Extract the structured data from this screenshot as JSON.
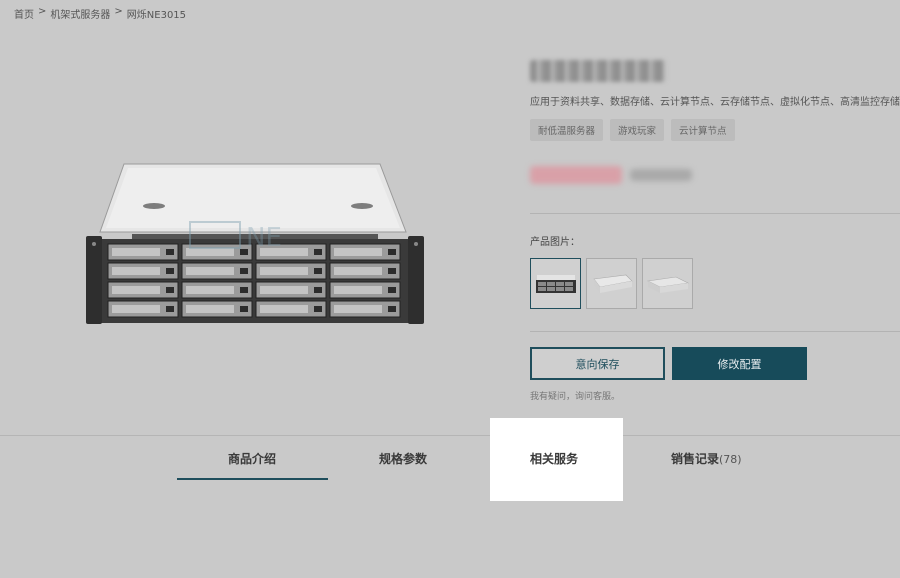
{
  "breadcrumb": {
    "home": "首页",
    "sep1": ">",
    "category": "机架式服务器",
    "sep2": ">",
    "current": "网烁NE3015"
  },
  "product": {
    "description": "应用于资料共享、数据存储、云计算节点、云存储节点、虚拟化节点、高清监控存储、流媒体转发等等。该配置拥有扩张性强，支持热插拔，存储空间大，维护方便的特点",
    "tags": [
      "耐低温服务器",
      "游戏玩家",
      "云计算节点"
    ],
    "pics_label": "产品图片：",
    "save_label": "意向保存",
    "config_label": "修改配置",
    "help_text": "我有疑问，询问客服。"
  },
  "tabs": {
    "intro": "商品介绍",
    "specs": "规格参数",
    "related": "相关服务",
    "sales": "销售记录",
    "sales_count": "(78)"
  },
  "colors": {
    "accent": "#1f4e5c",
    "button_primary": "#174b5a",
    "background": "#c9c9c9"
  }
}
